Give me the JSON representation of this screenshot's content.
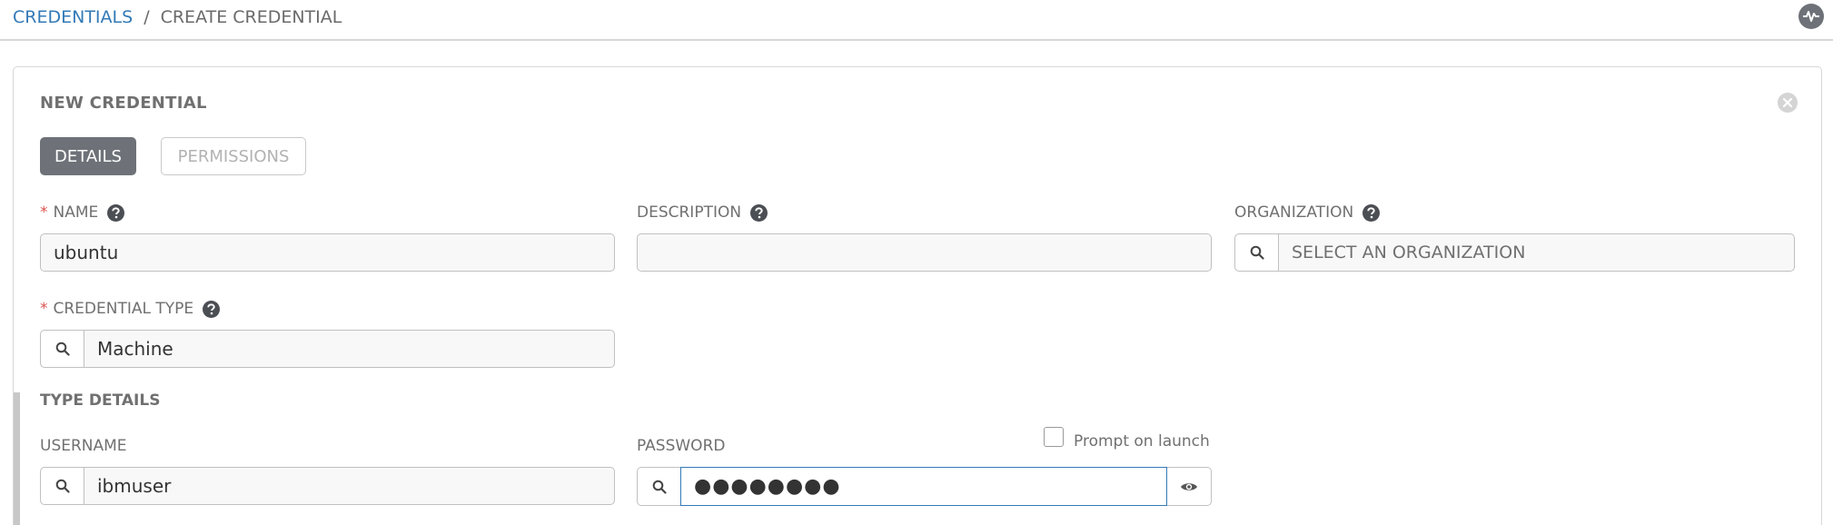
{
  "breadcrumb": {
    "root": "CREDENTIALS",
    "separator": "/",
    "current": "CREATE CREDENTIAL"
  },
  "panel": {
    "title": "NEW CREDENTIAL",
    "tabs": [
      {
        "label": "DETAILS",
        "active": true
      },
      {
        "label": "PERMISSIONS",
        "active": false
      }
    ]
  },
  "fields": {
    "name": {
      "required_mark": "*",
      "label": "NAME",
      "value": "ubuntu"
    },
    "description": {
      "label": "DESCRIPTION",
      "value": ""
    },
    "organization": {
      "label": "ORGANIZATION",
      "placeholder": "SELECT AN ORGANIZATION"
    },
    "credential_type": {
      "required_mark": "*",
      "label": "CREDENTIAL TYPE",
      "value": "Machine"
    }
  },
  "type_details": {
    "title": "TYPE DETAILS",
    "username": {
      "label": "USERNAME",
      "value": "ibmuser"
    },
    "password": {
      "label": "PASSWORD",
      "masked_value": "●●●●●●●●",
      "prompt_on_launch_label": "Prompt on launch",
      "prompt_on_launch_checked": false
    }
  },
  "icons": {
    "activity": "activity-stream-icon",
    "close": "close-icon",
    "help": "question-circle-icon",
    "search": "search-icon",
    "eye": "eye-icon"
  },
  "colors": {
    "link": "#337ab7",
    "required": "#d9534f",
    "active_tab": "#6e7278",
    "focus_border": "#337ab7"
  }
}
